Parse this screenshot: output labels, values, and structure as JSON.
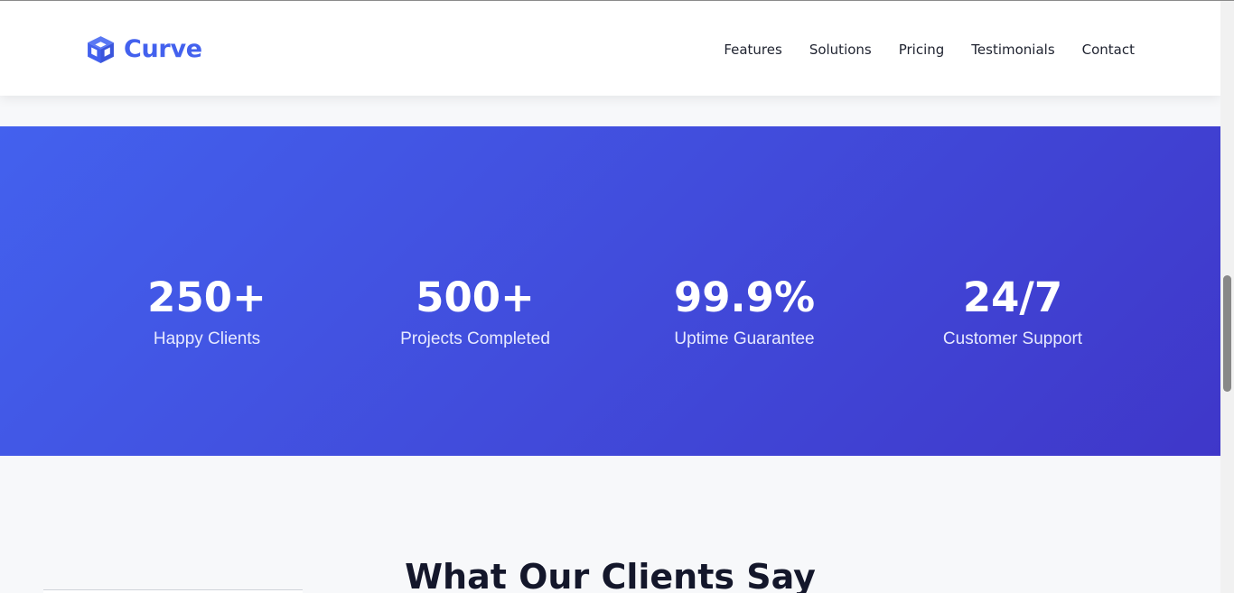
{
  "header": {
    "logo_text": "Curve",
    "logo_icon": "cube-icon",
    "nav": [
      "Features",
      "Solutions",
      "Pricing",
      "Testimonials",
      "Contact"
    ]
  },
  "stats": [
    {
      "value": "250+",
      "label": "Happy Clients"
    },
    {
      "value": "500+",
      "label": "Projects Completed"
    },
    {
      "value": "99.9%",
      "label": "Uptime Guarantee"
    },
    {
      "value": "24/7",
      "label": "Customer Support"
    }
  ],
  "testimonials": {
    "title": "What Our Clients Say"
  },
  "colors": {
    "accent": "#4361ee",
    "gradient_end": "#3f37c9",
    "heading": "#14172b",
    "section_bg": "#f7f8fa"
  }
}
